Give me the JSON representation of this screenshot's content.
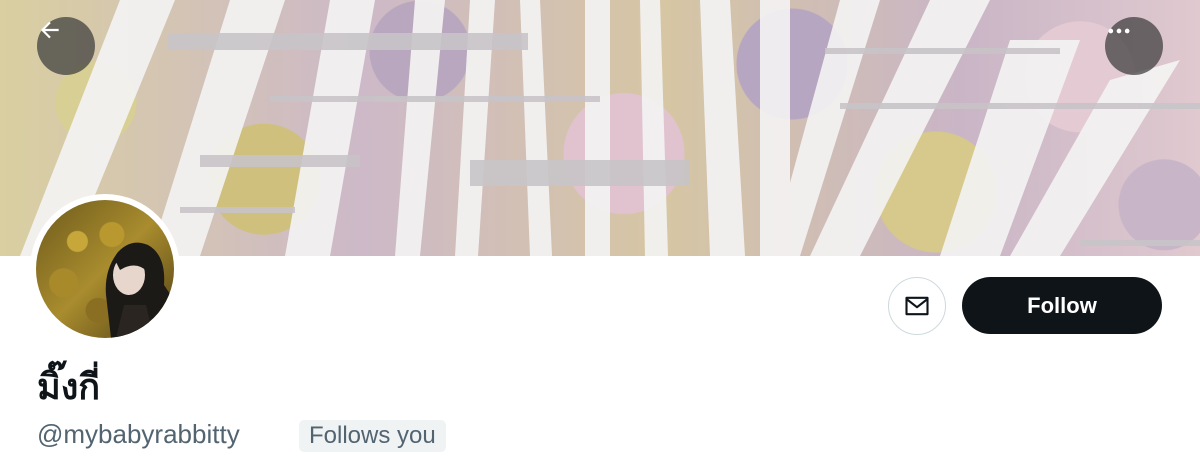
{
  "header": {
    "back_icon": "arrow-left-icon",
    "more_icon": "more-horizontal-icon"
  },
  "profile": {
    "display_name": "มิ๊งกี่",
    "handle": "@mybabyrabbitty",
    "follows_you_label": "Follows you",
    "follow_label": "Follow",
    "message_icon": "envelope-icon"
  },
  "colors": {
    "follow_button_bg": "#0f1419",
    "text_primary": "#0f1419",
    "text_secondary": "#536471",
    "badge_bg": "#eff3f4"
  }
}
